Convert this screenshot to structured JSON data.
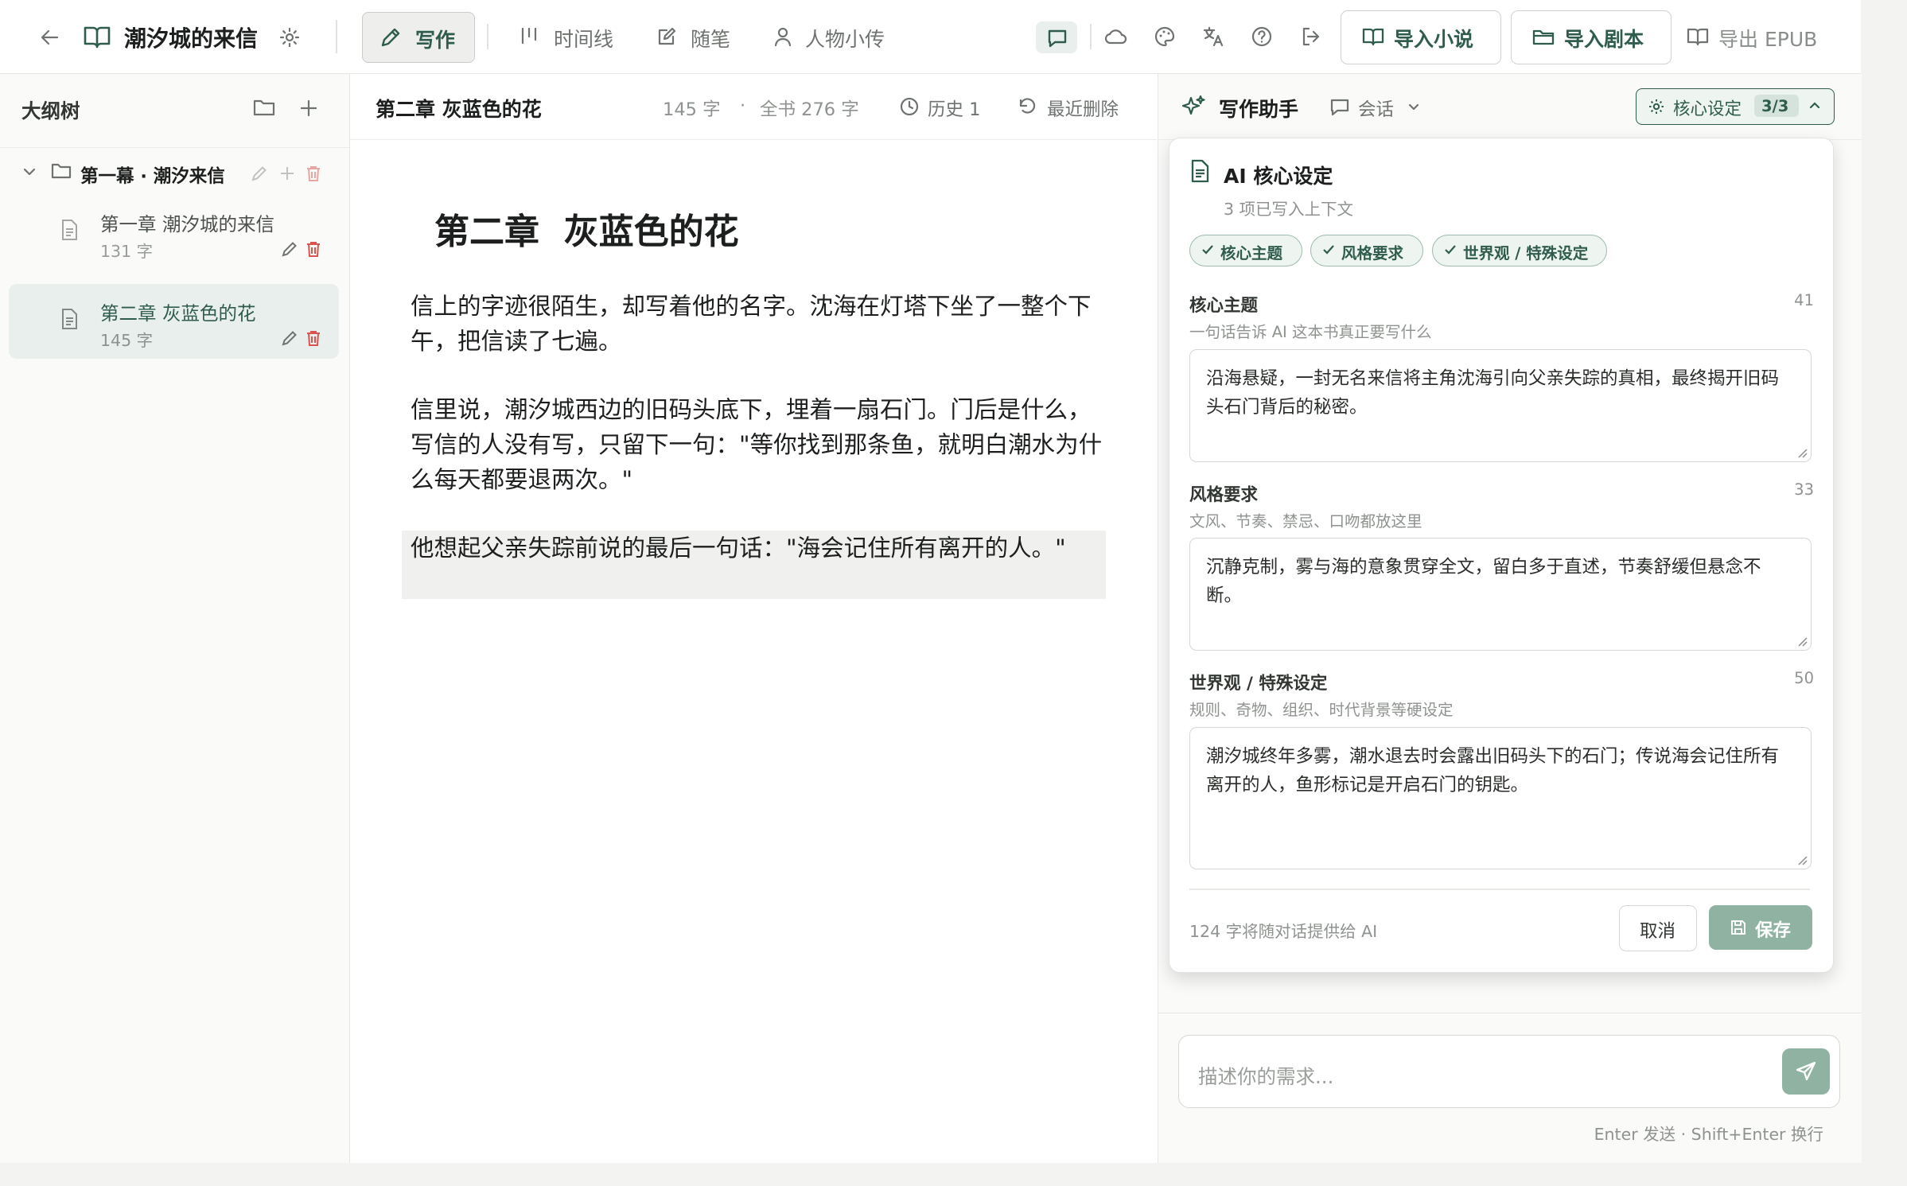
{
  "header": {
    "book_title": "潮汐城的来信",
    "tabs": [
      {
        "label": "写作",
        "active": true
      },
      {
        "label": "时间线"
      },
      {
        "label": "随笔"
      },
      {
        "label": "人物小传"
      }
    ],
    "import_novel": "导入小说",
    "import_script": "导入剧本",
    "export_epub": "导出 EPUB"
  },
  "sidebar": {
    "title": "大纲树",
    "act": "第一幕 · 潮汐来信",
    "chapters": [
      {
        "title": "第一章 潮汐城的来信",
        "count": "131 字"
      },
      {
        "title": "第二章 灰蓝色的花",
        "count": "145 字",
        "selected": true
      }
    ]
  },
  "editor": {
    "chapter_title": "第二章 灰蓝色的花",
    "word_count": "145 字",
    "dot": "·",
    "book_count": "全书 276 字",
    "history": "历史 1",
    "recent_deleted": "最近删除",
    "heading": "第二章  灰蓝色的花",
    "paragraphs": [
      "信上的字迹很陌生，却写着他的名字。沈海在灯塔下坐了一整个下午，把信读了七遍。",
      "信里说，潮汐城西边的旧码头底下，埋着一扇石门。门后是什么，写信的人没有写，只留下一句：\"等你找到那条鱼，就明白潮水为什么每天都要退两次。\"",
      "他想起父亲失踪前说的最后一句话：\"海会记住所有离开的人。\""
    ]
  },
  "assistant": {
    "title": "写作助手",
    "session": "会话",
    "core_settings_label": "核心设定",
    "core_settings_badge": "3/3",
    "input_placeholder": "描述你的需求...",
    "hint": "Enter 发送 · Shift+Enter 换行"
  },
  "popup": {
    "title": "AI 核心设定",
    "subtitle": "3 项已写入上下文",
    "chips": [
      "核心主题",
      "风格要求",
      "世界观 / 特殊设定"
    ],
    "fields": [
      {
        "label": "核心主题",
        "hint": "一句话告诉 AI 这本书真正要写什么",
        "count": "41",
        "value": "沿海悬疑，一封无名来信将主角沈海引向父亲失踪的真相，最终揭开旧码头石门背后的秘密。"
      },
      {
        "label": "风格要求",
        "hint": "文风、节奏、禁忌、口吻都放这里",
        "count": "33",
        "value": "沉静克制，雾与海的意象贯穿全文，留白多于直述，节奏舒缓但悬念不断。"
      },
      {
        "label": "世界观 / 特殊设定",
        "hint": "规则、奇物、组织、时代背景等硬设定",
        "count": "50",
        "value": "潮汐城终年多雾，潮水退去时会露出旧码头下的石门；传说海会记住所有离开的人，鱼形标记是开启石门的钥匙。"
      }
    ],
    "footer_note": "124 字将随对话提供给 AI",
    "cancel": "取消",
    "save": "保存"
  },
  "colors": {
    "accent": "#2f5c4d",
    "selected_bg": "#e9efec",
    "danger": "#d9534f",
    "save_bg": "#8fb2a3"
  },
  "icons": [
    "back-arrow-icon",
    "book-icon",
    "gear-icon",
    "pen-icon",
    "timeline-icon",
    "notes-icon",
    "person-icon",
    "chat-icon",
    "cloud-icon",
    "palette-icon",
    "translate-icon",
    "help-icon",
    "logout-icon",
    "folder-icon",
    "plus-icon",
    "trash-icon",
    "file-icon",
    "chevron-down-icon",
    "history-icon",
    "undo-icon",
    "sparkle-icon",
    "send-icon",
    "save-icon",
    "check-icon"
  ]
}
